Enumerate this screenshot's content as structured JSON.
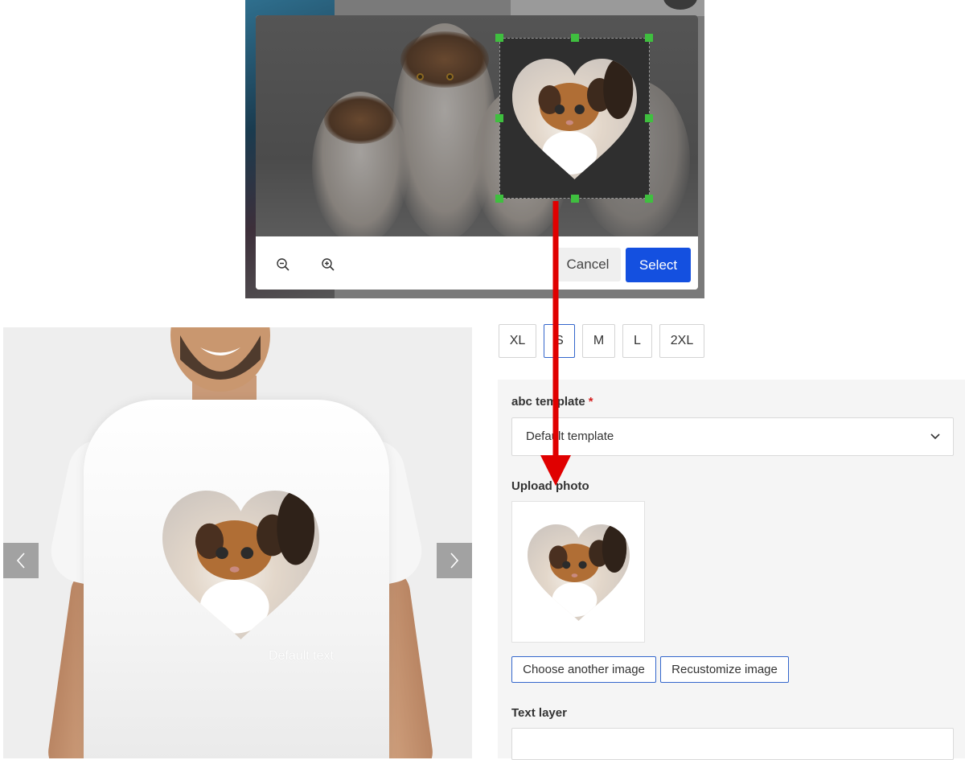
{
  "modal": {
    "cancel_label": "Cancel",
    "select_label": "Select",
    "zoom_out_icon": "zoom-out-icon",
    "zoom_in_icon": "zoom-in-icon"
  },
  "gallery": {
    "print_text": "Default text",
    "prev_icon": "chevron-left-icon",
    "next_icon": "chevron-right-icon"
  },
  "sizes": [
    "XL",
    "S",
    "M",
    "L",
    "2XL"
  ],
  "selected_size": "S",
  "template": {
    "label": "abc template",
    "required_mark": "*",
    "value": "Default template",
    "chevron_icon": "chevron-down-icon"
  },
  "upload": {
    "label": "Upload photo",
    "choose_label": "Choose another image",
    "recustomize_label": "Recustomize image"
  },
  "text_layer": {
    "label": "Text layer",
    "value": ""
  },
  "colors": {
    "accent": "#1450e0",
    "handle": "#3fbf3f",
    "arrow": "#e00000",
    "required": "#d42020"
  }
}
